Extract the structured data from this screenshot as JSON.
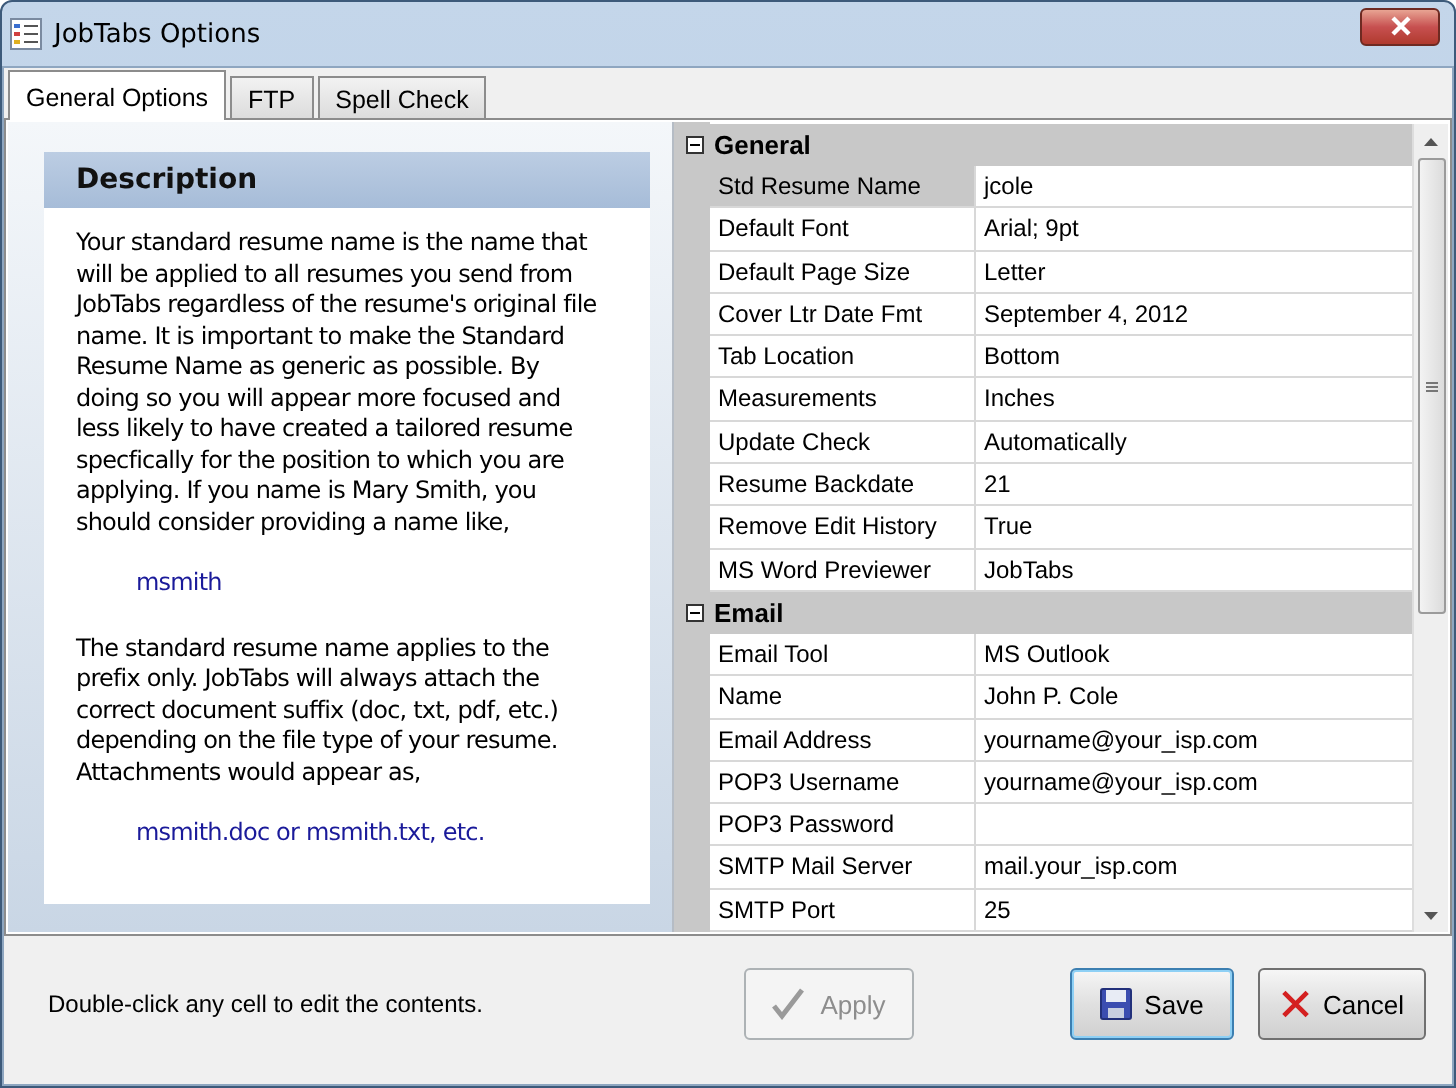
{
  "window": {
    "title": "JobTabs Options"
  },
  "tabs": [
    {
      "label": "General Options",
      "selected": true
    },
    {
      "label": "FTP",
      "selected": false
    },
    {
      "label": "Spell Check",
      "selected": false
    }
  ],
  "description": {
    "title": "Description",
    "paragraphs": [
      {
        "kind": "text",
        "text": "Your standard resume name is the name that will be applied to all resumes you send from JobTabs regardless of the resume's original file name. It is important to make the Standard Resume Name as generic as possible. By doing so you will appear more focused and less likely to have created a tailored resume specfically for the position to which you are applying. If you name is Mary Smith, you should consider providing a name like,"
      },
      {
        "kind": "example",
        "text": "msmith"
      },
      {
        "kind": "text",
        "text": "The standard resume name applies to the prefix only. JobTabs will always attach the correct document suffix (doc, txt, pdf, etc.) depending on the file type of your resume. Attachments would appear as,"
      },
      {
        "kind": "example",
        "text": "msmith.doc or msmith.txt, etc."
      }
    ]
  },
  "property_grid": {
    "groups": [
      {
        "name": "General",
        "expanded": true,
        "rows": [
          {
            "label": "Std Resume Name",
            "value": "jcole",
            "selected": true
          },
          {
            "label": "Default Font",
            "value": "Arial; 9pt",
            "selected": false
          },
          {
            "label": "Default Page Size",
            "value": "Letter",
            "selected": false
          },
          {
            "label": "Cover Ltr Date Fmt",
            "value": "September 4, 2012",
            "selected": false
          },
          {
            "label": "Tab Location",
            "value": "Bottom",
            "selected": false
          },
          {
            "label": "Measurements",
            "value": "Inches",
            "selected": false
          },
          {
            "label": "Update Check",
            "value": "Automatically",
            "selected": false
          },
          {
            "label": "Resume Backdate",
            "value": "21",
            "selected": false
          },
          {
            "label": "Remove Edit History",
            "value": "True",
            "selected": false
          },
          {
            "label": "MS Word Previewer",
            "value": "JobTabs",
            "selected": false
          }
        ]
      },
      {
        "name": "Email",
        "expanded": true,
        "rows": [
          {
            "label": "Email Tool",
            "value": "MS Outlook",
            "selected": false
          },
          {
            "label": "Name",
            "value": "John P. Cole",
            "selected": false
          },
          {
            "label": "Email Address",
            "value": "yourname@your_isp.com",
            "selected": false
          },
          {
            "label": "POP3 Username",
            "value": "yourname@your_isp.com",
            "selected": false
          },
          {
            "label": "POP3 Password",
            "value": "",
            "selected": false
          },
          {
            "label": "SMTP Mail Server",
            "value": "mail.your_isp.com",
            "selected": false
          },
          {
            "label": "SMTP Port",
            "value": "25",
            "selected": false
          }
        ]
      }
    ]
  },
  "status_text": "Double-click any cell to edit the contents.",
  "buttons": [
    {
      "kind": "apply",
      "label": "Apply",
      "disabled": true
    },
    {
      "kind": "save",
      "label": "Save",
      "disabled": false
    },
    {
      "kind": "cancel",
      "label": "Cancel",
      "disabled": false
    }
  ]
}
